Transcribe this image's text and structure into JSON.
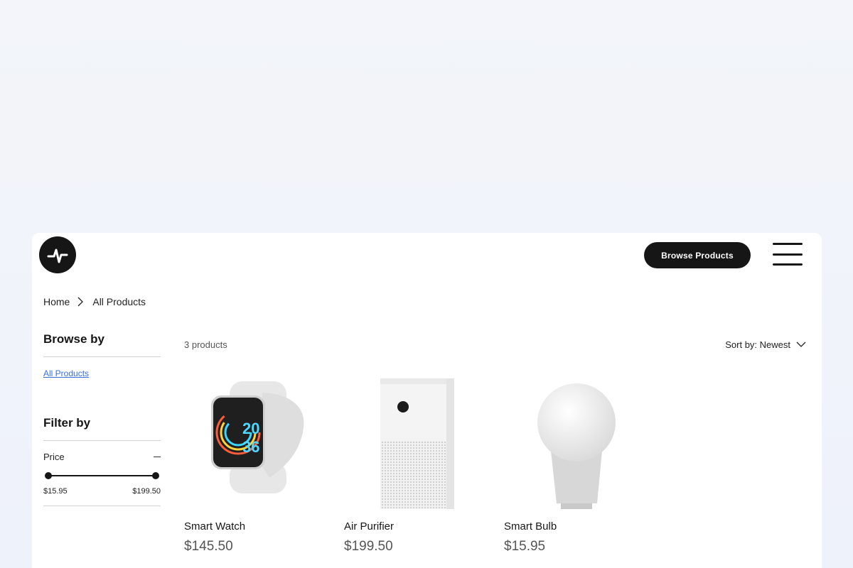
{
  "header": {
    "logo_icon": "pulse-logo-icon",
    "browse_label": "Browse Products",
    "menu_icon": "hamburger-menu-icon"
  },
  "breadcrumb": {
    "home": "Home",
    "current": "All Products"
  },
  "sidebar": {
    "browse_title": "Browse by",
    "browse_link": "All Products",
    "filter_title": "Filter by",
    "price_label": "Price",
    "price_min": "$15.95",
    "price_max": "$199.50"
  },
  "listing": {
    "count": "3 products",
    "sort_label": "Sort by: Newest"
  },
  "products": [
    {
      "name": "Smart Watch",
      "price": "$145.50",
      "image_icon": "smart-watch-image"
    },
    {
      "name": "Air Purifier",
      "price": "$199.50",
      "image_icon": "air-purifier-image"
    },
    {
      "name": "Smart Bulb",
      "price": "$15.95",
      "image_icon": "smart-bulb-image"
    }
  ],
  "watch_face": {
    "top": "20",
    "bottom": "36"
  },
  "colors": {
    "accent_dark": "#161616",
    "link": "#3a6fd8",
    "background": "#eef2fb"
  }
}
